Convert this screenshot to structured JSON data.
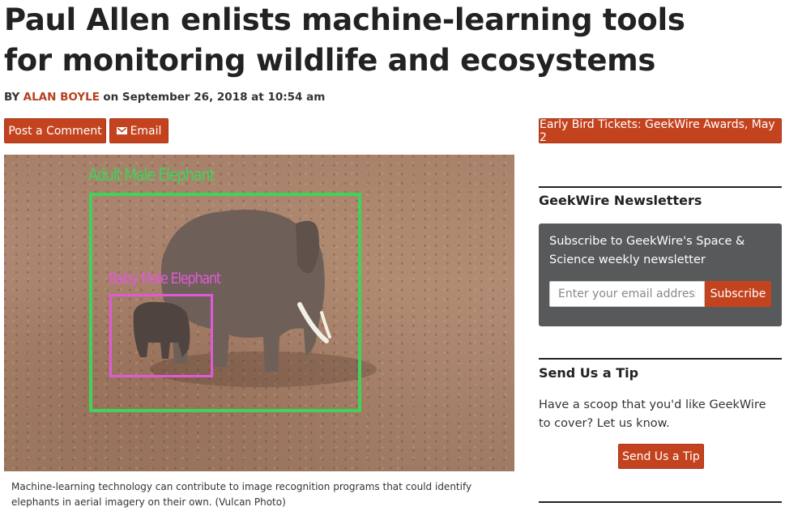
{
  "article": {
    "title": "Paul Allen enlists machine-learning tools for monitoring wildlife and ecosystems",
    "byline_prefix": "BY",
    "author": "ALAN BOYLE",
    "date_text": "on September 26, 2018 at 10:54 am"
  },
  "actions": {
    "comment_label": "Post a Comment",
    "email_label": "Email",
    "email_icon": "mail-icon"
  },
  "image": {
    "label_adult": "Adult Male Elephant",
    "label_baby": "Baby Male Elephant",
    "colors": {
      "adult_box": "#3fd35a",
      "baby_box": "#e05ad8"
    },
    "caption": "Machine-learning technology can contribute to image recognition programs that could identify elephants in aerial imagery on their own. (Vulcan Photo)"
  },
  "sidebar": {
    "promo_label": "Early Bird Tickets: GeekWire Awards, May 2",
    "newsletters": {
      "heading": "GeekWire Newsletters",
      "text": "Subscribe to GeekWire's Space & Science weekly newsletter",
      "email_placeholder": "Enter your email address",
      "subscribe_label": "Subscribe"
    },
    "tip": {
      "heading": "Send Us a Tip",
      "text": "Have a scoop that you'd like GeekWire to cover? Let us know.",
      "button_label": "Send Us a Tip"
    }
  },
  "colors": {
    "accent": "#c4431f",
    "author_link": "#b8401e",
    "newsletter_bg": "#58595b"
  }
}
